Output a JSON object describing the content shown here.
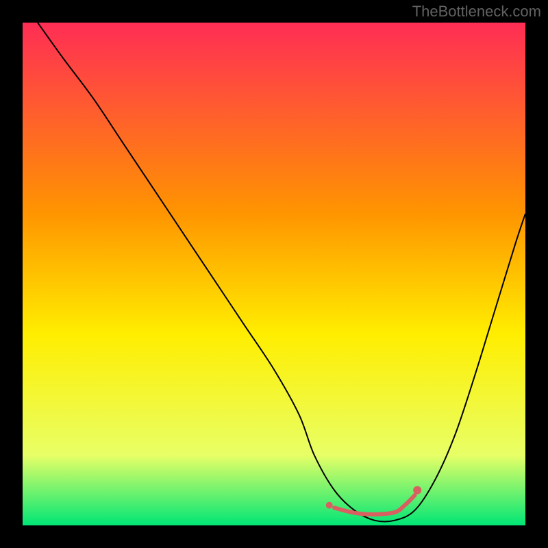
{
  "watermark": "TheBottleneck.com",
  "chart_data": {
    "type": "line",
    "title": "",
    "xlabel": "",
    "ylabel": "",
    "xlim": [
      0,
      100
    ],
    "ylim": [
      0,
      100
    ],
    "gradient_colors": {
      "top": "#ff2d55",
      "mid_upper": "#ff9500",
      "mid": "#ffee00",
      "mid_lower": "#e8ff66",
      "bottom": "#00e676"
    },
    "series": [
      {
        "name": "bottleneck-curve",
        "color": "#000000",
        "stroke_width": 2,
        "x": [
          3,
          8,
          14,
          20,
          26,
          32,
          38,
          44,
          50,
          55,
          58,
          62,
          66,
          70,
          74,
          78,
          82,
          86,
          90,
          94,
          98,
          100
        ],
        "values": [
          100,
          93,
          85,
          76,
          67,
          58,
          49,
          40,
          31,
          22,
          14,
          7,
          3,
          1,
          1,
          3,
          9,
          18,
          30,
          43,
          56,
          62
        ]
      },
      {
        "name": "optimal-zone",
        "color": "#d86060",
        "stroke_width": 6,
        "x": [
          62,
          66,
          70,
          74,
          76,
          78
        ],
        "values": [
          3.5,
          2.5,
          2.2,
          2.6,
          4,
          6
        ]
      }
    ],
    "markers": [
      {
        "name": "optimal-start",
        "x": 61,
        "y": 4,
        "color": "#d86060",
        "radius": 5
      },
      {
        "name": "optimal-end",
        "x": 78.5,
        "y": 7,
        "color": "#d86060",
        "radius": 6
      }
    ]
  }
}
